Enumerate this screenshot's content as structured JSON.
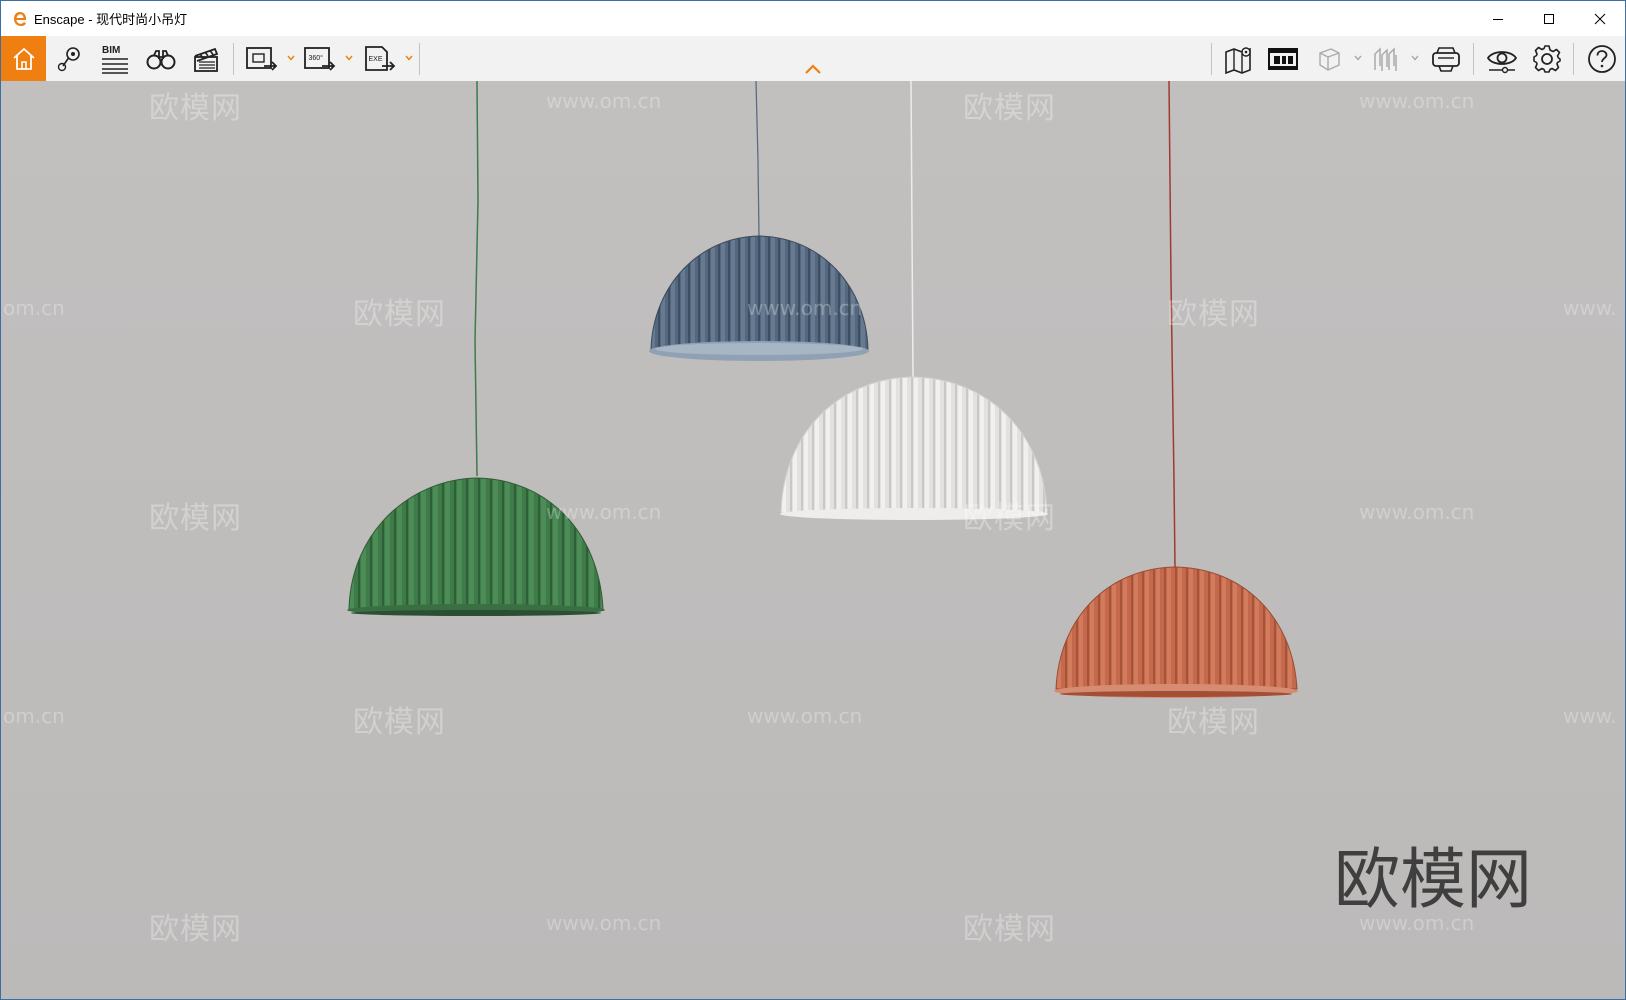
{
  "window": {
    "title": "Enscape - 现代时尚小吊灯",
    "app_icon": "enscape-logo-icon",
    "controls": [
      "minimize-icon",
      "maximize-icon",
      "close-icon"
    ]
  },
  "toolbar": {
    "left_buttons": [
      {
        "name": "home-button",
        "icon": "home-icon"
      },
      {
        "name": "views-button",
        "icon": "map-pin-icon"
      },
      {
        "name": "bim-button",
        "icon": "bim-icon",
        "label": "BIM"
      },
      {
        "name": "walk-mode-button",
        "icon": "binoculars-icon"
      },
      {
        "name": "video-editor-button",
        "icon": "clapperboard-icon"
      },
      {
        "name": "screenshot-button",
        "icon": "screenshot-export-icon"
      },
      {
        "name": "panorama-button",
        "icon": "panorama-export-icon",
        "label": "360°"
      },
      {
        "name": "standalone-export-button",
        "icon": "exe-export-icon",
        "label": "EXE"
      }
    ],
    "right_buttons": [
      {
        "name": "map-button",
        "icon": "map-icon"
      },
      {
        "name": "asset-library-button",
        "icon": "asset-library-icon"
      },
      {
        "name": "material-editor-button",
        "icon": "cube-icon"
      },
      {
        "name": "sections-button",
        "icon": "section-icon"
      },
      {
        "name": "vr-headset-button",
        "icon": "vr-headset-icon"
      },
      {
        "name": "visual-settings-button",
        "icon": "eye-icon"
      },
      {
        "name": "settings-button",
        "icon": "gear-icon"
      },
      {
        "name": "help-button",
        "icon": "help-icon"
      }
    ],
    "accent_color": "#f07f12"
  },
  "viewport": {
    "background_color": "#bfbdbc",
    "lamps": [
      {
        "name": "green-pendant-lamp",
        "color": "#3f7a49"
      },
      {
        "name": "blue-pendant-lamp",
        "color": "#54677e"
      },
      {
        "name": "white-pendant-lamp",
        "color": "#e2e1df"
      },
      {
        "name": "terracotta-pendant-lamp",
        "color": "#c4694b"
      }
    ],
    "watermark_text": "欧模网",
    "watermark_url": "www.om.cn",
    "watermark_url_partial": "om.cn",
    "watermark_url_partial_right": "www.",
    "brand_watermark": "欧模网"
  }
}
